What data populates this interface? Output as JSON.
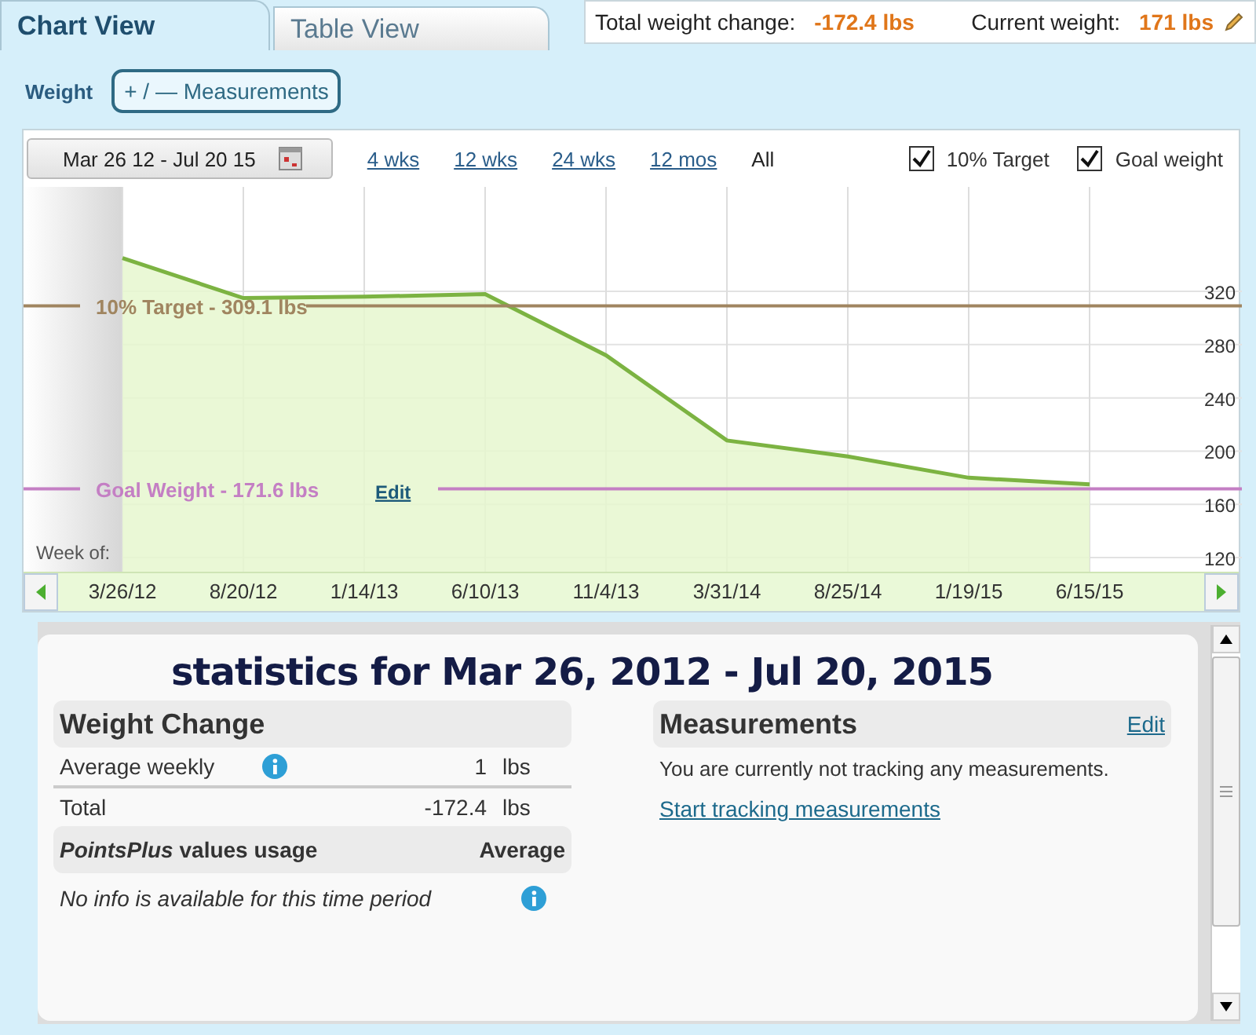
{
  "tabs": [
    {
      "label": "Chart View",
      "selected": true
    },
    {
      "label": "Table View",
      "selected": false
    }
  ],
  "summary": [
    {
      "label": "Total weight change:",
      "value": "-172.4  lbs"
    },
    {
      "label": "Current weight:",
      "value": "171  lbs"
    }
  ],
  "toolbar": {
    "label": "Weight",
    "button": "+ / — Measurements"
  },
  "chart": {
    "date_range": "Mar 26 12 - Jul 20 15",
    "periods": [
      {
        "label": "4 wks",
        "selected": false
      },
      {
        "label": "12 wks",
        "selected": false
      },
      {
        "label": "24 wks",
        "selected": false
      },
      {
        "label": "12 mos",
        "selected": false
      },
      {
        "label": "All",
        "selected": true
      }
    ],
    "toggles": [
      {
        "label": "10% Target",
        "checked": true
      },
      {
        "label": "Goal weight",
        "checked": true
      }
    ],
    "axis_caption": "Week of:",
    "edit_link": "Edit",
    "chart_data": {
      "type": "area",
      "categories": [
        "3/26/12",
        "8/20/12",
        "1/14/13",
        "6/10/13",
        "11/4/13",
        "3/31/14",
        "8/25/14",
        "1/19/15",
        "6/15/15"
      ],
      "series": [
        {
          "color": "#7cb342",
          "values": [
            345,
            315,
            316,
            318,
            272,
            208,
            196,
            180,
            175
          ]
        }
      ],
      "ylim": [
        109.4,
        441
      ],
      "yticks": [
        120,
        160,
        200,
        240,
        280,
        320
      ],
      "grid": true,
      "ref_lines": [
        {
          "axis": "y",
          "value": 309.1,
          "label": "10% Target - 309.1 lbs",
          "color": "#a08560"
        },
        {
          "axis": "y",
          "value": 171.6,
          "label": "Goal Weight - 171.6 lbs",
          "color": "#c47fc4"
        }
      ]
    }
  },
  "statistics": {
    "title": "statistics for Mar 26, 2012 - Jul 20, 2015",
    "weight_change": {
      "header": "Weight Change",
      "rows": [
        {
          "label": "Average weekly",
          "info": true,
          "value": "1",
          "unit": "lbs"
        },
        {
          "label": "Total",
          "info": false,
          "value": "-172.4",
          "unit": "lbs"
        }
      ]
    },
    "points": {
      "header": "*PointsPlus* values usage",
      "column": "Average",
      "note": "No info is available for this time period"
    },
    "measurements": {
      "header": "Measurements",
      "edit": "Edit",
      "text": "You are currently not tracking any measurements.",
      "link": "Start tracking measurements"
    }
  }
}
